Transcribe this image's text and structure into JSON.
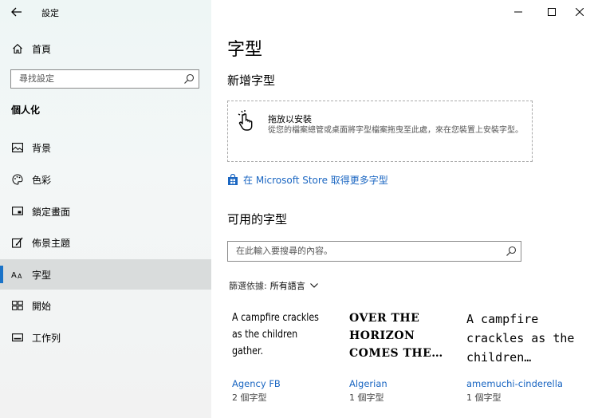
{
  "app": {
    "title": "設定"
  },
  "sidebar": {
    "home": "首頁",
    "search_placeholder": "尋找設定",
    "section": "個人化",
    "items": [
      {
        "label": "背景",
        "icon": "image-icon"
      },
      {
        "label": "色彩",
        "icon": "palette-icon"
      },
      {
        "label": "鎖定畫面",
        "icon": "lock-screen-icon"
      },
      {
        "label": "佈景主題",
        "icon": "theme-brush-icon"
      },
      {
        "label": "字型",
        "icon": "font-icon",
        "active": true
      },
      {
        "label": "開始",
        "icon": "start-grid-icon"
      },
      {
        "label": "工作列",
        "icon": "taskbar-icon"
      }
    ]
  },
  "main": {
    "title": "字型",
    "add_title": "新增字型",
    "drop_title": "拖放以安裝",
    "drop_desc": "從您的檔案總管或桌面將字型檔案拖曳至此處，來在您裝置上安裝字型。",
    "store_link": "在 Microsoft Store 取得更多字型",
    "available_title": "可用的字型",
    "search_placeholder": "在此輸入要搜尋的內容。",
    "filter_label": "篩選依據:",
    "filter_value": "所有語言",
    "fonts": [
      {
        "sample": "A campfire crackles as the children gather.",
        "name": "Agency FB",
        "count": "2 個字型"
      },
      {
        "sample": "OVER THE HORIZON COMES THE…",
        "name": "Algerian",
        "count": "1 個字型"
      },
      {
        "sample": "A campfire crackles as the children…",
        "name": "amemuchi-cinderella",
        "count": "1 個字型"
      }
    ]
  },
  "colors": {
    "accent": "#1a66c2",
    "active_bg": "#d9dcdc",
    "active_bar": "#1a73c8"
  }
}
